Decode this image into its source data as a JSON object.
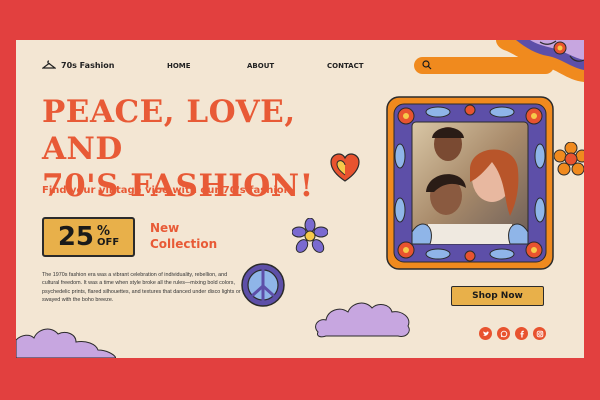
{
  "brand": {
    "name": "70s Fashion",
    "icon": "hanger-icon"
  },
  "nav": {
    "home": "HOME",
    "about": "ABOUT",
    "contact": "CONTACT"
  },
  "search": {
    "placeholder": "",
    "icon": "search-icon"
  },
  "hero": {
    "headline_line1": "PEACE, LOVE, AND",
    "headline_line2": "70'S FASHION!",
    "subtitle": "Find your vintage vibe with our 70's fashion",
    "promo_number": "25",
    "promo_percent": "%",
    "promo_off": "OFF",
    "promo_label_line1": "New",
    "promo_label_line2": "Collection",
    "description": "The 1970s fashion era was a vibrant celebration of individuality, rebellion, and cultural freedom. It was a time when style broke all the rules—mixing bold colors, psychedelic prints, flared silhouettes, and textures that danced under disco lights or swayed with the boho breeze."
  },
  "cta": {
    "shop_now": "Shop Now"
  },
  "socials": [
    "twitter-icon",
    "whatsapp-icon",
    "facebook-icon",
    "instagram-icon"
  ],
  "colors": {
    "background": "#e2403f",
    "card": "#f3e6d3",
    "accent": "#e85a36",
    "orange": "#f08a1e",
    "gold": "#e8b04a",
    "purple": "#5d4fa8",
    "lilac": "#c7a6e0"
  }
}
